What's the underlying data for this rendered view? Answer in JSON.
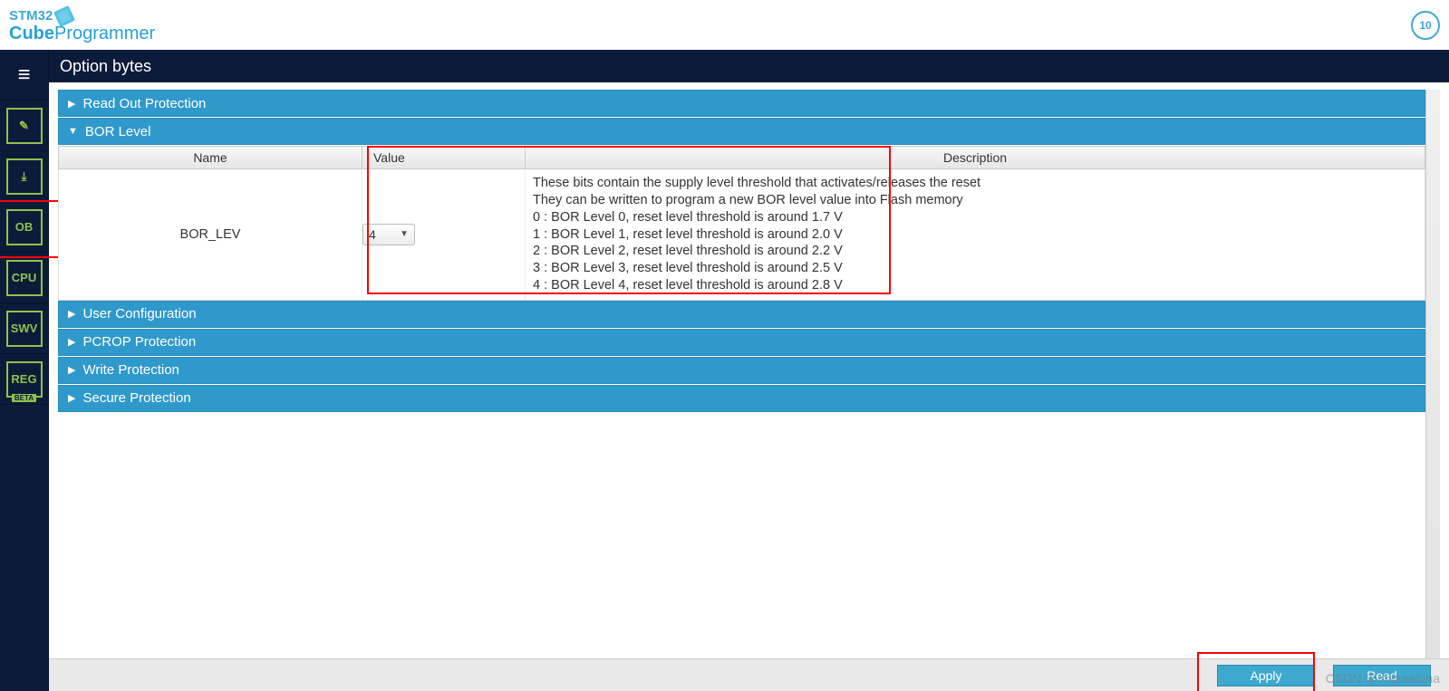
{
  "logo": {
    "line1": "STM32",
    "line2_prefix": "Cube",
    "line2_suffix": "Programmer"
  },
  "badge": "10",
  "title": "Option bytes",
  "sidebar": {
    "items": [
      {
        "label": "≡",
        "is_menu": true
      },
      {
        "label": "✎"
      },
      {
        "label": "⤓"
      },
      {
        "label": "OB",
        "highlighted": true
      },
      {
        "label": "CPU"
      },
      {
        "label": "SWV"
      },
      {
        "label": "REG",
        "beta": "BETA"
      }
    ]
  },
  "panels": [
    {
      "label": "Read Out Protection",
      "expanded": false
    },
    {
      "label": "BOR Level",
      "expanded": true
    },
    {
      "label": "User Configuration",
      "expanded": false
    },
    {
      "label": "PCROP Protection",
      "expanded": false
    },
    {
      "label": "Write Protection",
      "expanded": false
    },
    {
      "label": "Secure Protection",
      "expanded": false
    }
  ],
  "table": {
    "headers": {
      "name": "Name",
      "value": "Value",
      "desc": "Description"
    },
    "row": {
      "name": "BOR_LEV",
      "value": "4",
      "desc_lines": [
        "These bits contain the supply level threshold that activates/releases the reset",
        "They can be written to program a new BOR level value into Flash memory",
        "0 : BOR Level 0, reset level threshold is around 1.7 V",
        "1 : BOR Level 1, reset level threshold is around 2.0 V",
        "2 : BOR Level 2, reset level threshold is around 2.2 V",
        "3 : BOR Level 3, reset level threshold is around 2.5 V",
        "4 : BOR Level 4, reset level threshold is around 2.8 V"
      ]
    }
  },
  "footer": {
    "apply": "Apply",
    "read": "Read"
  },
  "watermark": "CSDN @Naturalona"
}
